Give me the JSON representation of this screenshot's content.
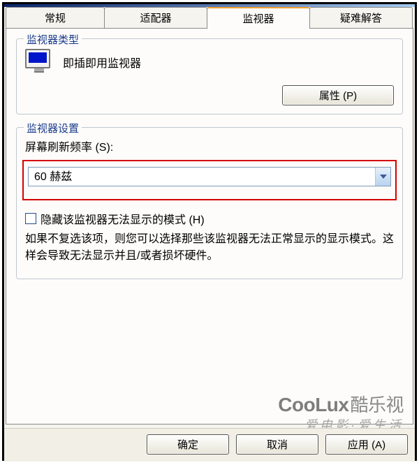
{
  "tabs": {
    "general": "常规",
    "adapter": "适配器",
    "monitor": "监视器",
    "troubleshoot": "疑难解答"
  },
  "group_type": {
    "title": "监视器类型",
    "pnp_label": "即插即用监视器",
    "properties_btn": "属性 (P)"
  },
  "group_settings": {
    "title": "监视器设置",
    "refresh_label": "屏幕刷新频率 (S):",
    "refresh_value": "60 赫兹",
    "hide_modes_label": "隐藏该监视器无法显示的模式 (H)",
    "hide_modes_checked": false,
    "hint": "如果不复选该项，则您可以选择那些该监视器无法正常显示的显示模式。这样会导致无法显示并且/或者损坏硬件。"
  },
  "buttons": {
    "ok": "确定",
    "cancel": "取消",
    "apply": "应用 (A)"
  },
  "watermark": {
    "brand_en": "CooLux",
    "brand_cn": "酷乐视",
    "tagline": "爱电影·爱生活"
  },
  "icons": {
    "monitor": "monitor-icon",
    "dropdown": "chevron-down-icon"
  }
}
